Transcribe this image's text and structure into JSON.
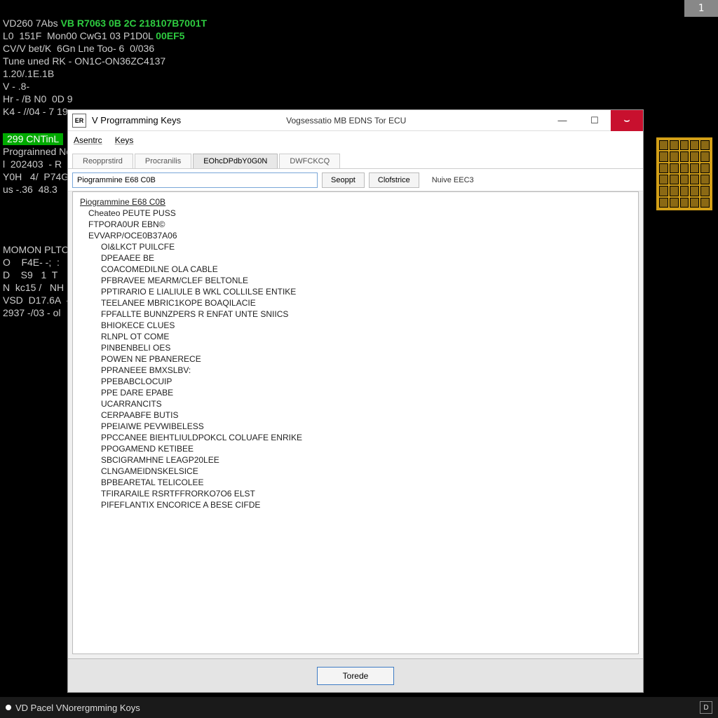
{
  "page_indicator": "1",
  "terminal": {
    "line1_a": "VD260 7Abs ",
    "line1_b": "VB R7063 0B 2C 218107B7001T",
    "line2_a": "L0  151F  Mon00 CwG1 03 P1D0L ",
    "line2_b": "00EF5",
    "line3": "CV/V bet/K  6Gn Lne Too- 6  0/036",
    "line4": "Tune uned RK - ON1C-ON36ZC4137",
    "line5": "1.20/.1E.1B",
    "line6": "V - .8-",
    "line7": "Hr - /B N0  0D 9",
    "line8": "K4 - //04 - 7 19",
    "sep": "299 CNTinL",
    "block2_l1": "Prograinned No",
    "block2_l2": "l  202403  - R",
    "block2_l3": "Y0H   4/  P74G",
    "block2_l4": "us -.36  48.3",
    "block3_l1": "MOMON PLTCONN",
    "block3_l2": "O    F4E- -;  :",
    "block3_l3": "D    S9   1  T ",
    "block3_l4": "N  kc15 /   NH",
    "block3_l5": "VSD  D17.6A  - ",
    "block3_l6": "2937 -/03 - ol"
  },
  "window": {
    "icon": "ER",
    "title": "V Progrramming Keys",
    "subtitle": "Vogsessatio MB EDNS Tor ECU",
    "min": "—",
    "max": "☐",
    "close": "⌣",
    "menu": {
      "m1": "Asentrc",
      "m2": "Keys"
    },
    "tabs": {
      "t1": "Reopprstird",
      "t2": "Procranilis",
      "t3": "EOhcDPdbY0G0N",
      "t4": "DWFCKCQ"
    },
    "toolbar": {
      "input_value": "Piogrammine E68 C0B",
      "b1": "Seoppt",
      "b2": "Clofstrice",
      "lbl": "Nuive EEC3"
    },
    "tree": {
      "root": "Piogrammine E68 C0B",
      "n1": "Cheateo PEUTE PUSS",
      "n2": "FTPORA0UR EBN©",
      "n3": "EVVARP/OCE0B37A06",
      "items": [
        "OI&LKCT PUILCFE",
        "DPEAAEE BE",
        "COACOMEDILNE OLA CABLE",
        "PFBRAVEE MEARM/CLEF BELTONLE",
        "PPTIRARIO E LIALIULE B WKL COLLILSE ENTIKE",
        "TEELANEE MBRIC1KOPE BOAQILACIE",
        "FPFALLTE BUNNZPERS R ENFAT UNTE SNIICS",
        "BHIOKECE CLUES",
        "RLNPL OT COME",
        "PINBENBELI OES",
        "POWEN NE PBANERECE",
        "PPRANEEE BMXSLBV:",
        "PPEBABCLOCUIP",
        "PPE DARE EPABE",
        "UCARRANCITS",
        "CERPAABFE BUTIS",
        "PPEIAIWE PEVWIBELESS",
        "PPCCANEE BIEHTLIULDPOKCL COLUAFE ENRIKE",
        "PPOGAMEND KETIBEE",
        "SBCIGRAMHNE LEAGP20LEE",
        "CLNGAMEIDNSKELSICE",
        "BPBEARETAL TELICOLEE",
        "TFIRARAILE RSRTFFRORKO7O6 ELST",
        "PIFEFLANTIX ENCORICE A BESE CIFDE"
      ]
    },
    "footer_btn": "Torede"
  },
  "taskbar": {
    "item": "VD Pacel VNorergmming Koys",
    "tray": "D"
  }
}
